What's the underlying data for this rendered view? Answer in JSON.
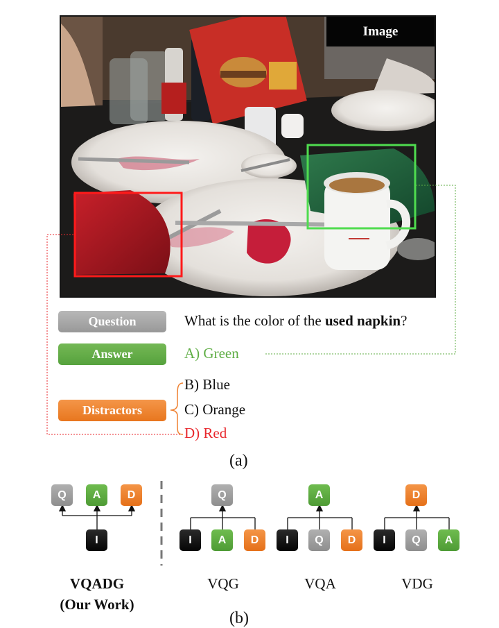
{
  "panel_a": {
    "image_badge": "Image",
    "labels": {
      "question": "Question",
      "answer": "Answer",
      "distractors": "Distractors"
    },
    "question_prefix": "What is the color of the ",
    "question_bold": "used napkin",
    "question_suffix": "?",
    "answer": "A) Green",
    "distractors": [
      "B) Blue",
      "C) Orange",
      "D) Red"
    ],
    "caption": "(a)",
    "colors": {
      "answer_box": "#3fbf3f",
      "wrong_box": "#ff1a1a",
      "answer_text": "#5fae45",
      "wrong_text": "#e8272c"
    }
  },
  "panel_b": {
    "node_letters": {
      "question": "Q",
      "answer": "A",
      "distractor": "D",
      "image": "I"
    },
    "methods": [
      {
        "name": "VQADG",
        "subname": "(Our Work)"
      },
      {
        "name": "VQG"
      },
      {
        "name": "VQA"
      },
      {
        "name": "VDG"
      }
    ],
    "caption": "(b)",
    "colors": {
      "question": "#9e9e9e",
      "answer": "#5fae45",
      "distractor": "#ef8030",
      "image": "#111111"
    }
  }
}
